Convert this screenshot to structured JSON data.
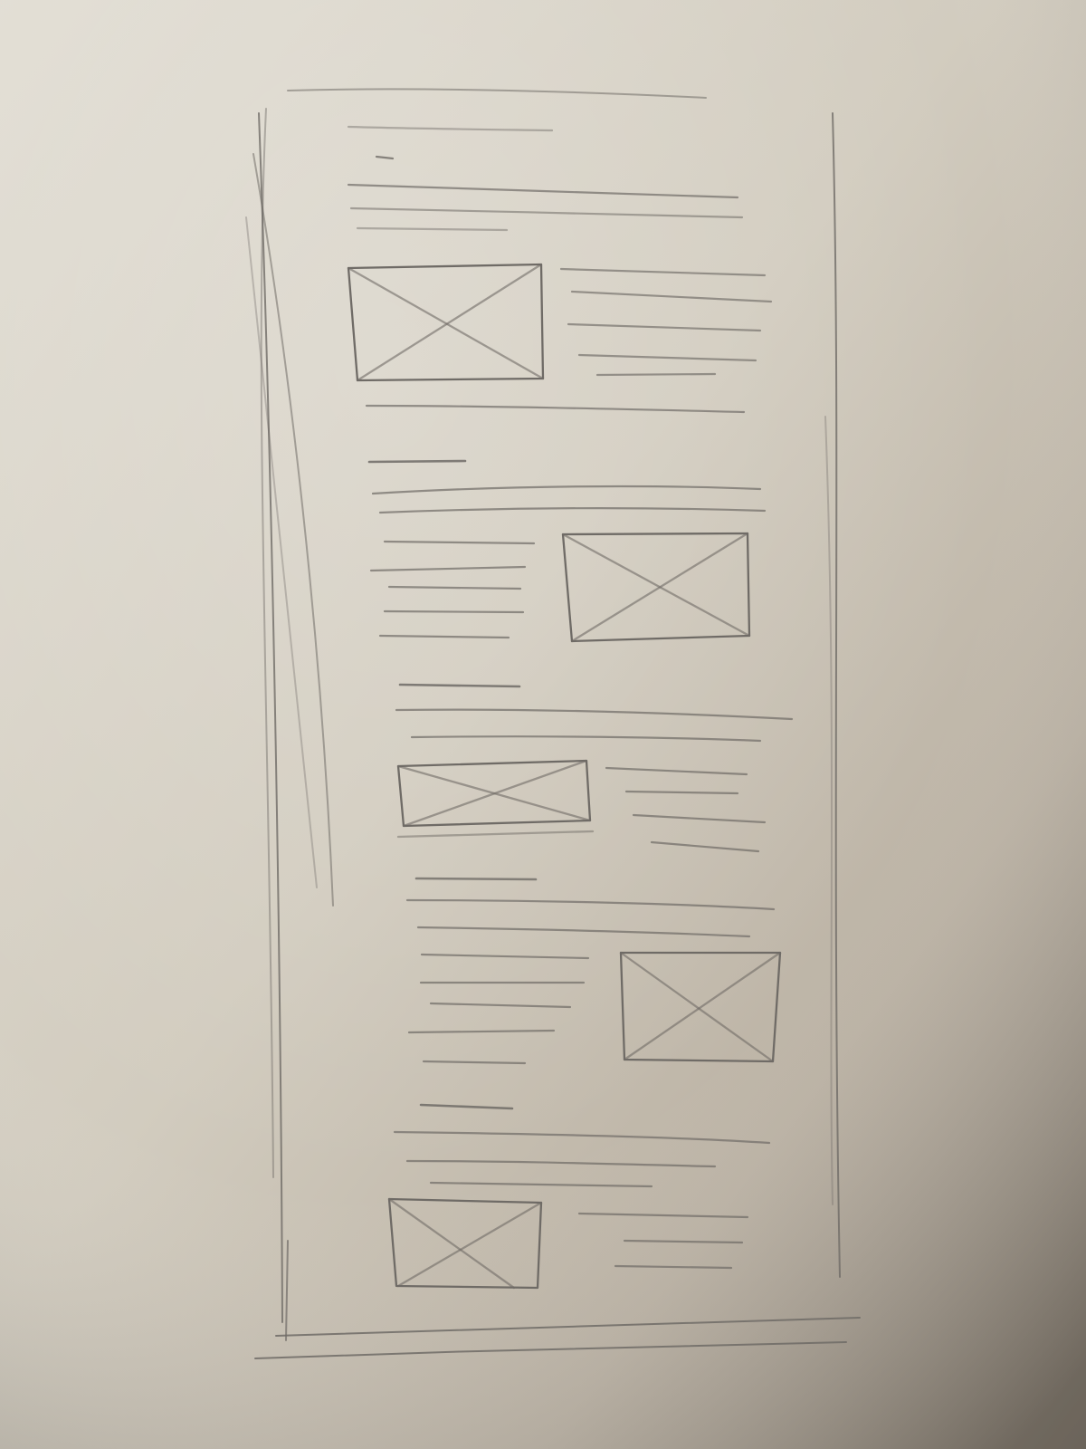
{
  "photo": {
    "subject": "pencil-wireframe-sketch-on-paper",
    "colors": {
      "paper_light": "#dcd7cc",
      "paper_mid": "#c6bfb1",
      "paper_shadow": "#968c7f",
      "pencil": "#6f6b66"
    },
    "sections": [
      {
        "id": "section-1",
        "image_position": "left"
      },
      {
        "id": "section-2",
        "image_position": "right"
      },
      {
        "id": "section-3",
        "image_position": "left"
      },
      {
        "id": "section-4",
        "image_position": "right"
      },
      {
        "id": "section-5",
        "image_position": "left"
      }
    ]
  }
}
